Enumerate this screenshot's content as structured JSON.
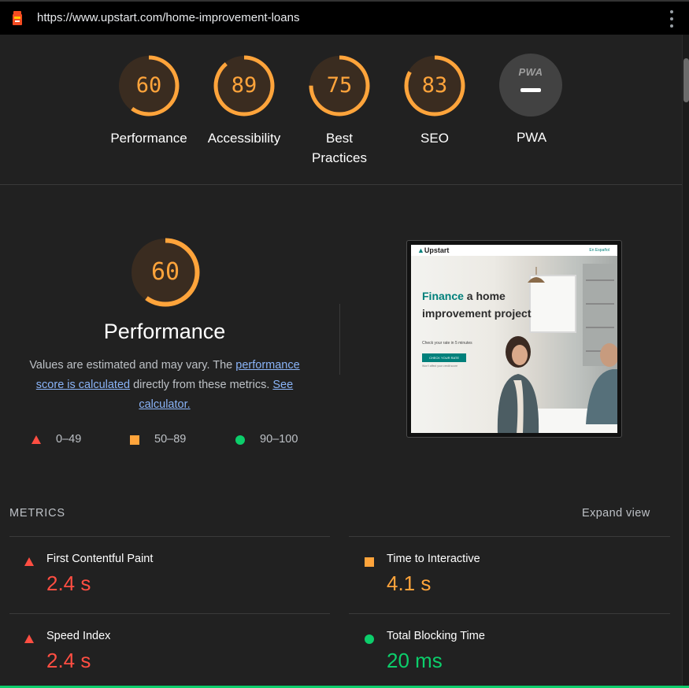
{
  "url_bar": {
    "url": "https://www.upstart.com/home-improvement-loans"
  },
  "colors": {
    "fail": "#ff4e42",
    "average": "#ffa43b",
    "pass": "#0cce6b",
    "link": "#8ab4f8",
    "background": "#212121"
  },
  "categories": [
    {
      "label": "Performance",
      "score": 60
    },
    {
      "label": "Accessibility",
      "score": 89
    },
    {
      "label": "Best Practices",
      "score": 75
    },
    {
      "label": "SEO",
      "score": 83
    },
    {
      "label": "PWA",
      "score": null,
      "badge_text": "PWA"
    }
  ],
  "performance": {
    "score": "60",
    "title": "Performance",
    "desc_prefix": "Values are estimated and may vary. The ",
    "desc_link1": "performance score is calculated",
    "desc_mid": " directly from these metrics. ",
    "desc_link2": "See calculator."
  },
  "legend": [
    {
      "icon": "fail-triangle-icon",
      "range": "0–49"
    },
    {
      "icon": "average-square-icon",
      "range": "50–89"
    },
    {
      "icon": "pass-circle-icon",
      "range": "90–100"
    }
  ],
  "screenshot": {
    "logo": "Upstart",
    "nav_right": "En Español",
    "headline_accent": "Finance",
    "headline_rest": " a home improvement project",
    "subtext": "Check your rate in 5 minutes",
    "button": "CHECK YOUR RATE",
    "small_note": "Won't affect your credit score"
  },
  "metrics": {
    "title": "METRICS",
    "expand_label": "Expand view",
    "items": [
      {
        "name": "First Contentful Paint",
        "value": "2.4 s",
        "status": "fail"
      },
      {
        "name": "Time to Interactive",
        "value": "4.1 s",
        "status": "average"
      },
      {
        "name": "Speed Index",
        "value": "2.4 s",
        "status": "fail"
      },
      {
        "name": "Total Blocking Time",
        "value": "20 ms",
        "status": "pass"
      }
    ]
  }
}
